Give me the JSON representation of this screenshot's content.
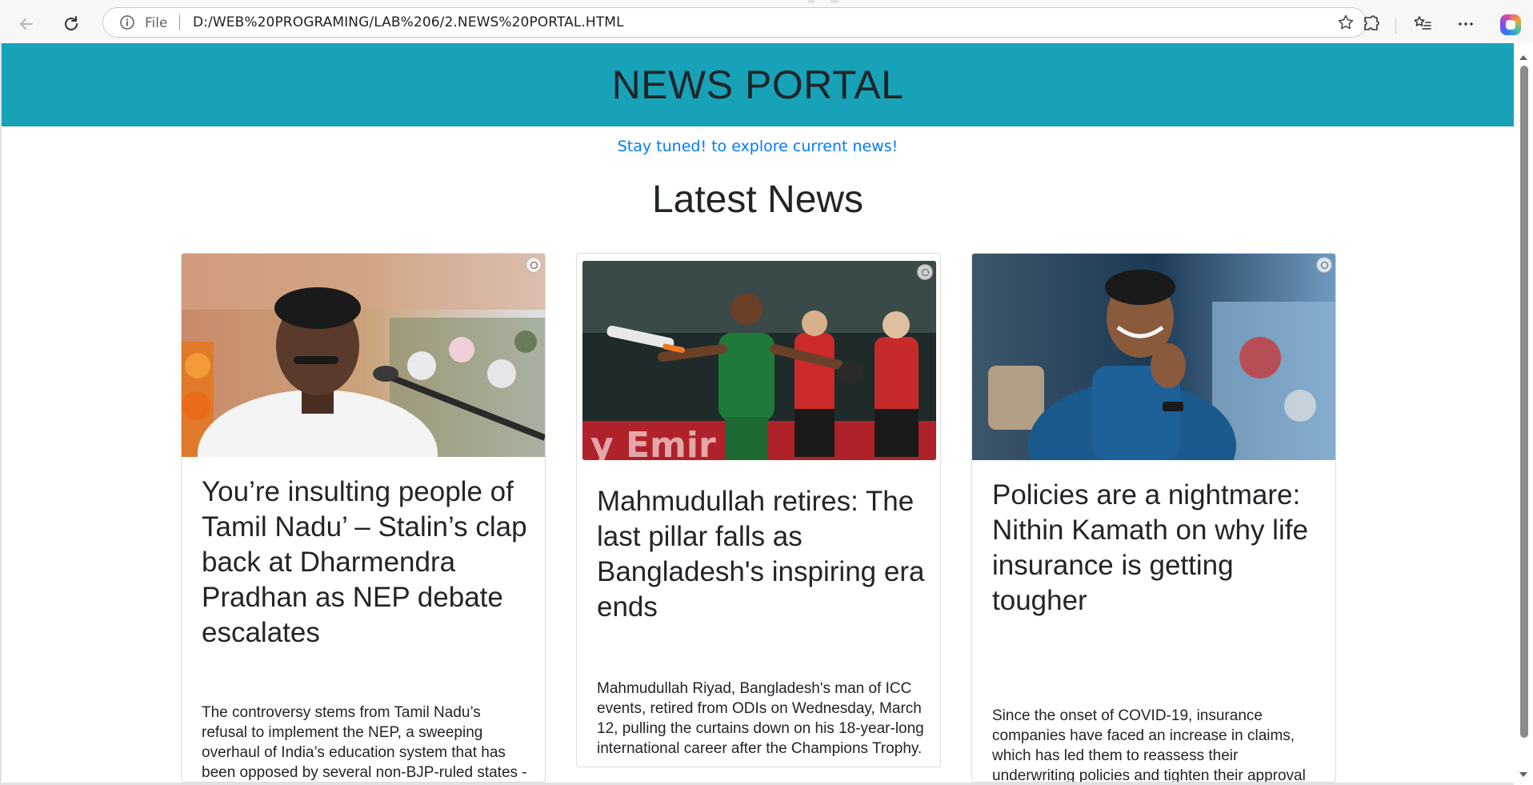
{
  "browser": {
    "protocol_label": "File",
    "url": "D:/WEB%20PROGRAMING/LAB%206/2.NEWS%20PORTAL.HTML",
    "icons": {
      "back": "back-arrow-icon",
      "reload": "reload-icon",
      "info": "info-icon",
      "favorite": "star-icon",
      "extensions": "extensions-icon",
      "favorites_bar": "favorites-list-icon",
      "menu": "more-menu-icon",
      "copilot": "copilot-icon"
    }
  },
  "page": {
    "header_title": "NEWS PORTAL",
    "tagline": "Stay tuned! to explore current news!",
    "section_title": "Latest News",
    "colors": {
      "header_bg": "#17a2b8",
      "tagline": "#007bff",
      "text": "#212529"
    }
  },
  "cards": [
    {
      "image": "stalin-speaking-at-microphone",
      "title": "You’re insulting people of Tamil Nadu’ – Stalin’s clap back at Dharmendra Pradhan as NEP debate escalates",
      "text": "The controversy stems from Tamil Nadu’s refusal to implement the NEP, a sweeping overhaul of India’s education system that has been opposed by several non-BJP-ruled states -- including Karnataka and Kerala."
    },
    {
      "image": "mahmudullah-celebrating-with-bat",
      "title": "Mahmudullah retires: The last pillar falls as Bangladesh's inspiring era ends",
      "text": "Mahmudullah Riyad, Bangladesh's man of ICC events, retired from ODIs on Wednesday, March 12, pulling the curtains down on his 18-year-long international career after the Champions Trophy."
    },
    {
      "image": "nithin-kamath-smiling",
      "title": "Policies are a nightmare: Nithin Kamath on why life insurance is getting tougher",
      "text": "Since the onset of COVID-19, insurance companies have faced an increase in claims, which has led them to reassess their underwriting policies and tighten their approval process."
    }
  ]
}
